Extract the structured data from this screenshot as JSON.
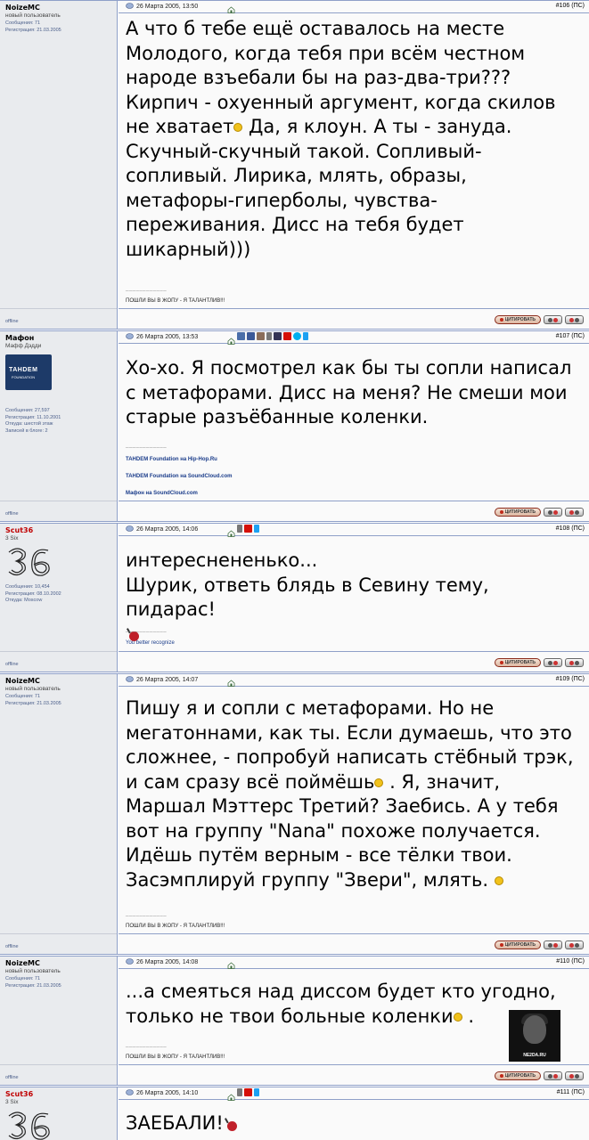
{
  "posts": [
    {
      "author": "NoizeMC",
      "author_color": "#000000",
      "rank": "новый пользователь",
      "stats": [
        "Сообщения: 71",
        "Регистрация: 21.03.2005"
      ],
      "date": "26 Марта 2005, 13:50",
      "number": "#106 (ПС)",
      "text_lines": [
        "А что б тебе ещё оставалось на месте",
        "Молодого, когда тебя при всём честном",
        "народе взъебали бы на раз-два-три???",
        "Кирпич - охуенный аргумент, когда скилов",
        "не хватает",
        "Да, я клоун. А ты - зануда.",
        "Скучный-скучный такой. Сопливый-",
        "сопливый. Лирика, млять, образы,",
        "метафоры-гиперболы, чувства-",
        "переживания. Дисс на тебя будет",
        "шикарный)))"
      ],
      "signature_separator": "____________",
      "signature": [
        "ПОШЛИ ВЫ В ЖОПУ - Я ТАЛАНТЛИВ!!!"
      ],
      "status": "offline"
    },
    {
      "author": "Мафон",
      "author_color": "#000000",
      "rank": "Мафф Дэдди",
      "stats": [
        "Сообщения: 27,597",
        "Регистрация: 11.10.2001",
        "Откуда: шестой этаж",
        "Записей в блоге: 2"
      ],
      "avatar_text": [
        "TAHDEM",
        "FOUNDATION"
      ],
      "date": "26 Марта 2005, 13:53",
      "number": "#107 (ПС)",
      "text_lines": [
        "Хо-хо. Я посмотрел как бы ты сопли написал",
        "с метафорами. Дисс на меня? Не смеши мои",
        "старые разъёбанные коленки."
      ],
      "signature_separator": "____________",
      "signature": [
        "TAHDEM Foundation на Hip-Hop.Ru",
        "TAHDEM Foundation на SoundCloud.com",
        "Мафон на SoundCloud.com"
      ],
      "status": "offline"
    },
    {
      "author": "Scut36",
      "author_color": "#c00000",
      "rank": "3 Six",
      "stats": [
        "Сообщения: 10,454",
        "Регистрация: 08.10.2002",
        "Откуда: Moscow"
      ],
      "date": "26 Марта 2005, 14:06",
      "number": "#108 (ПС)",
      "text_lines": [
        "интереснененько...",
        "Шурик, ответь блядь в Севину тему, пидарас!"
      ],
      "signature_separator": "____________",
      "signature": [
        "You better recognize"
      ],
      "status": "offline"
    },
    {
      "author": "NoizeMC",
      "author_color": "#000000",
      "rank": "новый пользователь",
      "stats": [
        "Сообщения: 71",
        "Регистрация: 21.03.2005"
      ],
      "date": "26 Марта 2005, 14:07",
      "number": "#109 (ПС)",
      "text_lines": [
        "Пишу я и сопли с метафорами. Но не",
        "мегатоннами, как ты. Если думаешь, что это",
        "сложнее, - попробуй написать стёбный трэк,",
        "и сам сразу всё поймёшь",
        ". Я, значит,",
        "Маршал Мэттерс Третий? Заебись. А у тебя",
        "вот на группу \"Nana\" похоже получается.",
        "Идёшь путём верным - все тёлки твои.",
        "Засэмплируй группу \"Звери\", млять."
      ],
      "signature_separator": "____________",
      "signature": [
        "ПОШЛИ ВЫ В ЖОПУ - Я ТАЛАНТЛИВ!!!"
      ],
      "status": "offline"
    },
    {
      "author": "NoizeMC",
      "author_color": "#000000",
      "rank": "новый пользователь",
      "stats": [
        "Сообщения: 71",
        "Регистрация: 21.03.2005"
      ],
      "date": "26 Марта 2005, 14:08",
      "number": "#110 (ПС)",
      "text_lines": [
        "...а смеяться над диссом будет кто угодно,",
        "только не твои больные коленки",
        "."
      ],
      "image_label": "NE2DA.RU",
      "signature_separator": "____________",
      "signature": [
        "ПОШЛИ ВЫ В ЖОПУ - Я ТАЛАНТЛИВ!!!"
      ],
      "status": "offline"
    },
    {
      "author": "Scut36",
      "author_color": "#c00000",
      "rank": "3 Six",
      "date": "26 Марта 2005, 14:10",
      "number": "#111 (ПС)",
      "text_lines": [
        "ЗАЕБАЛИ!"
      ]
    }
  ],
  "buttons": {
    "quote": "ЦИТИРОВАТЬ"
  },
  "colors": {
    "border": "#8fa0c8",
    "left_bg": "#e9ebee",
    "accent_red": "#c00000"
  }
}
